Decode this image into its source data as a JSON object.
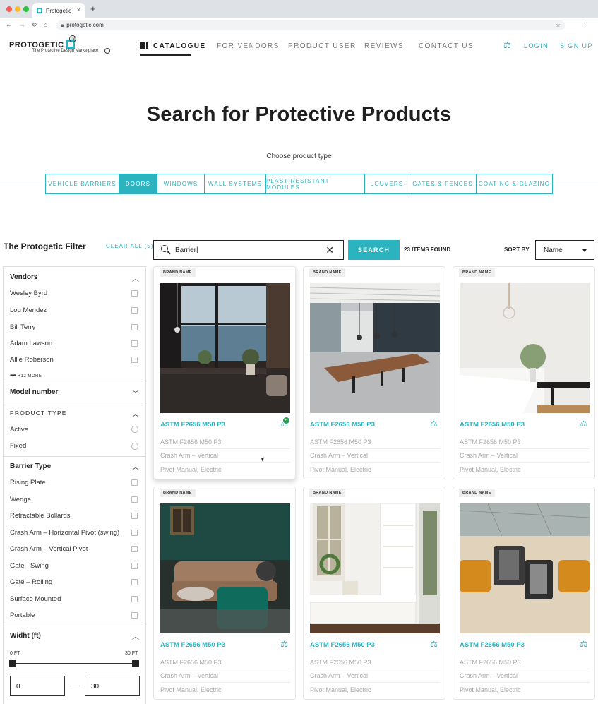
{
  "browser": {
    "tab_title": "Protogetic",
    "tab_close": "×",
    "new_tab": "+",
    "url": "protogetic.com"
  },
  "header": {
    "logo": "PROTOGETIC",
    "logo_mark": "TM",
    "tagline": "The Protective Design Marketplace",
    "nav": [
      "CATALOGUE",
      "FOR VENDORS",
      "PRODUCT USER",
      "REVIEWS",
      "CONTACT US"
    ],
    "login": "LOGIN",
    "signup": "SIGN UP"
  },
  "hero": {
    "title": "Search for Protective Products",
    "subtitle": "Choose product type",
    "types": [
      "VEHICLE BARRIERS",
      "DOORS",
      "WINDOWS",
      "WALL SYSTEMS",
      "PLAST RESISTANT MODULES",
      "LOUVERS",
      "GATES & FENCES",
      "COATING & GLAZING"
    ],
    "selected_type": "DOORS"
  },
  "filter": {
    "title": "The Protogetic Filter",
    "clear_all": "CLEAR ALL (5)",
    "vendors_heading": "Vendors",
    "vendors": [
      "Wesley Byrd",
      "Lou Mendez",
      "Bill Terry",
      "Adam Lawson",
      "Allie Roberson"
    ],
    "more": "+12 MORE",
    "model_number": "Model number",
    "product_type_heading": "PRODUCT TYPE",
    "product_types": [
      "Active",
      "Fixed"
    ],
    "barrier_type_heading": "Barrier Type",
    "barrier_types": [
      "Rising Plate",
      "Wedge",
      "Retractable Bollards",
      "Crash Arm – Horizontal Pivot (swing)",
      "Crash Arm – Vertical Pivot",
      "Gate - Swing",
      "Gate – Rolling",
      "Surface Mounted",
      "Portable"
    ],
    "width_heading": "Widht (ft)",
    "range_min_label": "0 FT",
    "range_max_label": "30 FT",
    "range_min": "0",
    "range_max": "30"
  },
  "search": {
    "value": "Barrier|",
    "button": "SEARCH",
    "found": "23 ITEMS FOUND",
    "sort_label": "SORT BY",
    "sort_value": "Name"
  },
  "products": [
    {
      "brand": "BRAND NAME",
      "title": "ASTM F2656 M50 P3",
      "line1": "ASTM F2656 M50 P3",
      "line2": "Crash Arm – Vertical",
      "line3": "Pivot Manual, Electric",
      "checked": true
    },
    {
      "brand": "BRAND NAME",
      "title": "ASTM F2656 M50 P3",
      "line1": "ASTM F2656 M50 P3",
      "line2": "Crash Arm – Vertical",
      "line3": "Pivot Manual, Electric",
      "checked": false
    },
    {
      "brand": "BRAND NAME",
      "title": "ASTM F2656 M50 P3",
      "line1": "ASTM F2656 M50 P3",
      "line2": "Crash Arm – Vertical",
      "line3": "Pivot Manual, Electric",
      "checked": false
    },
    {
      "brand": "BRAND NAME",
      "title": "ASTM F2656 M50 P3",
      "line1": "ASTM F2656 M50 P3",
      "line2": "Crash Arm – Vertical",
      "line3": "Pivot Manual, Electric",
      "checked": false
    },
    {
      "brand": "BRAND NAME",
      "title": "ASTM F2656 M50 P3",
      "line1": "ASTM F2656 M50 P3",
      "line2": "Crash Arm – Vertical",
      "line3": "Pivot Manual, Electric",
      "checked": false
    },
    {
      "brand": "BRAND NAME",
      "title": "ASTM F2656 M50 P3",
      "line1": "ASTM F2656 M50 P3",
      "line2": "Crash Arm – Vertical",
      "line3": "Pivot Manual, Electric",
      "checked": false
    }
  ],
  "colors": {
    "accent": "#2bb3c0",
    "check": "#2e9e57"
  }
}
